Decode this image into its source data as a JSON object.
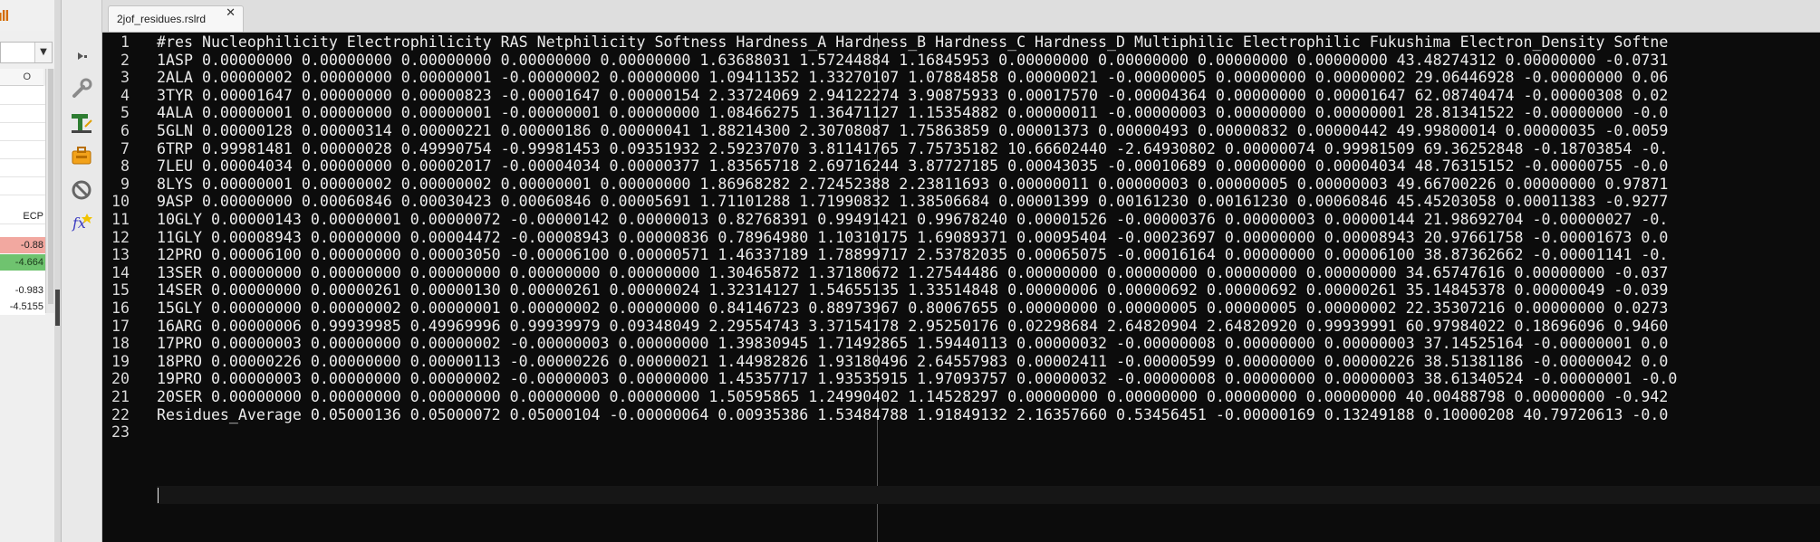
{
  "left_panel": {
    "column_header": "O",
    "ecp_header": "ECP",
    "cell_values": [
      "-0.88",
      "-4.664",
      "-0.983",
      "-4.5155"
    ],
    "combo_arrow": "▼"
  },
  "editor": {
    "tab_title": "2jof_residues.rslrd",
    "tab_close": "✕",
    "line_numbers": [
      "1",
      "2",
      "3",
      "4",
      "5",
      "6",
      "7",
      "8",
      "9",
      "10",
      "11",
      "12",
      "13",
      "14",
      "15",
      "16",
      "17",
      "18",
      "19",
      "20",
      "21",
      "22",
      "23"
    ],
    "lines": [
      "#res Nucleophilicity Electrophilicity RAS Netphilicity Softness Hardness_A Hardness_B Hardness_C Hardness_D Multiphilic Electrophilic Fukushima Electron_Density Softne",
      "1ASP 0.00000000 0.00000000 0.00000000 0.00000000 0.00000000 1.63688031 1.57244884 1.16845953 0.00000000 0.00000000 0.00000000 0.00000000 43.48274312 0.00000000 -0.0731",
      "2ALA 0.00000002 0.00000000 0.00000001 -0.00000002 0.00000000 1.09411352 1.33270107 1.07884858 0.00000021 -0.00000005 0.00000000 0.00000002 29.06446928 -0.00000000 0.06",
      "3TYR 0.00001647 0.00000000 0.00000823 -0.00001647 0.00000154 2.33724069 2.94122274 3.90875933 0.00017570 -0.00004364 0.00000000 0.00001647 62.08740474 -0.00000308 0.02",
      "4ALA 0.00000001 0.00000000 0.00000001 -0.00000001 0.00000000 1.08466275 1.36471127 1.15354882 0.00000011 -0.00000003 0.00000000 0.00000001 28.81341522 -0.00000000 -0.0",
      "5GLN 0.00000128 0.00000314 0.00000221 0.00000186 0.00000041 1.88214300 2.30708087 1.75863859 0.00001373 0.00000493 0.00000832 0.00000442 49.99800014 0.00000035 -0.0059",
      "6TRP 0.99981481 0.00000028 0.49990754 -0.99981453 0.09351932 2.59237070 3.81141765 7.75735182 10.66602440 -2.64930802 0.00000074 0.99981509 69.36252848 -0.18703854 -0.",
      "7LEU 0.00004034 0.00000000 0.00002017 -0.00004034 0.00000377 1.83565718 2.69716244 3.87727185 0.00043035 -0.00010689 0.00000000 0.00004034 48.76315152 -0.00000755 -0.0",
      "8LYS 0.00000001 0.00000002 0.00000002 0.00000001 0.00000000 1.86968282 2.72452388 2.23811693 0.00000011 0.00000003 0.00000005 0.00000003 49.66700226 0.00000000 0.97871",
      "9ASP 0.00000000 0.00060846 0.00030423 0.00060846 0.00005691 1.71101288 1.71990832 1.38506684 0.00001399 0.00161230 0.00161230 0.00060846 45.45203058 0.00011383 -0.9277",
      "10GLY 0.00000143 0.00000001 0.00000072 -0.00000142 0.00000013 0.82768391 0.99491421 0.99678240 0.00001526 -0.00000376 0.00000003 0.00000144 21.98692704 -0.00000027 -0.",
      "11GLY 0.00008943 0.00000000 0.00004472 -0.00008943 0.00000836 0.78964980 1.10310175 1.69089371 0.00095404 -0.00023697 0.00000000 0.00008943 20.97661758 -0.00001673 0.0",
      "12PRO 0.00006100 0.00000000 0.00003050 -0.00006100 0.00000571 1.46337189 1.78899717 2.53782035 0.00065075 -0.00016164 0.00000000 0.00006100 38.87362662 -0.00001141 -0.",
      "13SER 0.00000000 0.00000000 0.00000000 0.00000000 0.00000000 1.30465872 1.37180672 1.27544486 0.00000000 0.00000000 0.00000000 0.00000000 34.65747616 0.00000000 -0.037",
      "14SER 0.00000000 0.00000261 0.00000130 0.00000261 0.00000024 1.32314127 1.54655135 1.33514848 0.00000006 0.00000692 0.00000692 0.00000261 35.14845378 0.00000049 -0.039",
      "15GLY 0.00000000 0.00000002 0.00000001 0.00000002 0.00000000 0.84146723 0.88973967 0.80067655 0.00000000 0.00000005 0.00000005 0.00000002 22.35307216 0.00000000 0.0273",
      "16ARG 0.00000006 0.99939985 0.49969996 0.99939979 0.09348049 2.29554743 3.37154178 2.95250176 0.02298684 2.64820904 2.64820920 0.99939991 60.97984022 0.18696096 0.9460",
      "17PRO 0.00000003 0.00000000 0.00000002 -0.00000003 0.00000000 1.39830945 1.71492865 1.59440113 0.00000032 -0.00000008 0.00000000 0.00000003 37.14525164 -0.00000001 0.0",
      "18PRO 0.00000226 0.00000000 0.00000113 -0.00000226 0.00000021 1.44982826 1.93180496 2.64557983 0.00002411 -0.00000599 0.00000000 0.00000226 38.51381186 -0.00000042 0.0",
      "19PRO 0.00000003 0.00000000 0.00000002 -0.00000003 0.00000000 1.45357717 1.93535915 1.97093757 0.00000032 -0.00000008 0.00000000 0.00000003 38.61340524 -0.00000001 -0.0",
      "20SER 0.00000000 0.00000000 0.00000000 0.00000000 0.00000000 1.50595865 1.24990402 1.14528297 0.00000000 0.00000000 0.00000000 0.00000000 40.00488798 0.00000000 -0.942",
      "Residues_Average 0.05000136 0.05000072 0.05000104 -0.00000064 0.00935386 1.53484788 1.91849132 2.16357660 0.53456451 -0.00000169 0.13249188 0.10000208 40.79720613 -0.0",
      ""
    ]
  },
  "toolbar": {
    "icons": [
      "move-handle-icon",
      "wrench-icon",
      "text-format-icon",
      "suitcase-icon",
      "prohibit-icon",
      "function-icon"
    ]
  },
  "colors": {
    "editor_bg": "#0c0c0c",
    "text": "#ececec",
    "accent_logo": "#d46a00",
    "cell_red": "#f2a8a0",
    "cell_green": "#6fc36f"
  }
}
